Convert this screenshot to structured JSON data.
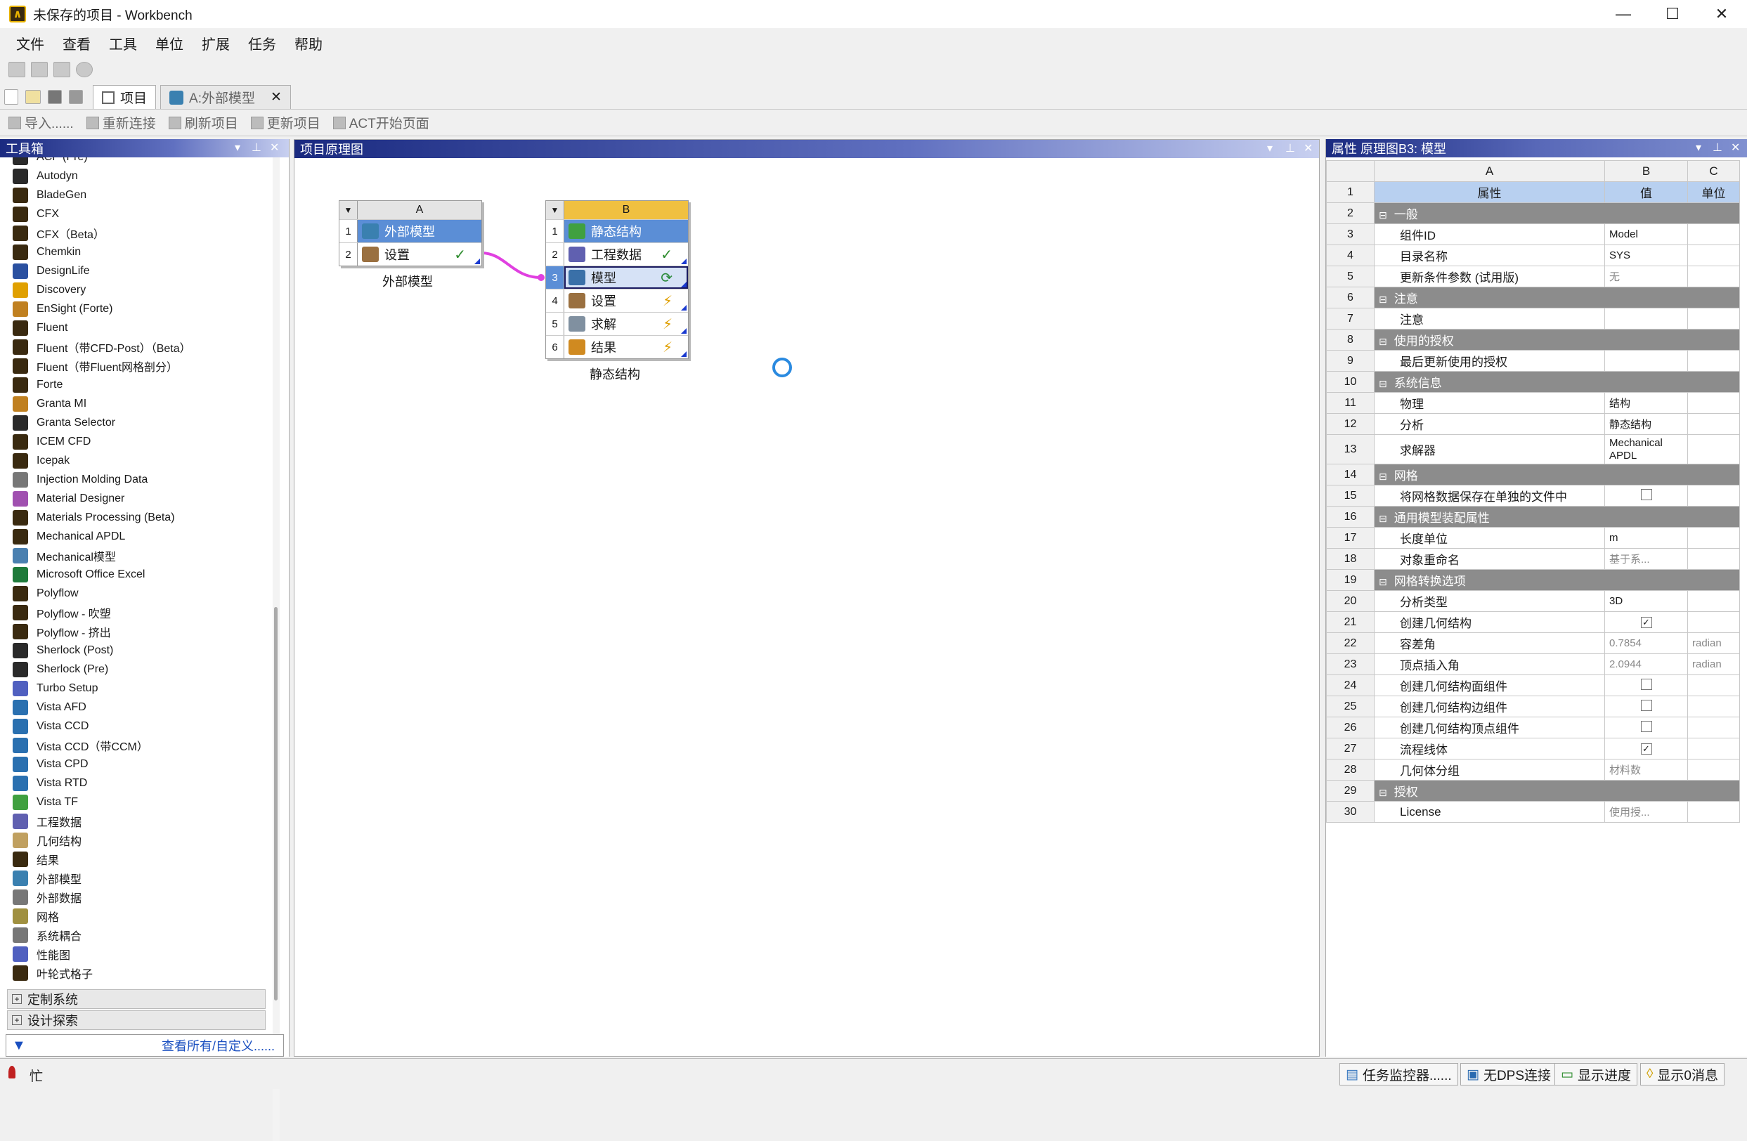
{
  "window": {
    "title": "未保存的项目 - Workbench"
  },
  "menu": [
    "文件",
    "查看",
    "工具",
    "单位",
    "扩展",
    "任务",
    "帮助"
  ],
  "tabs": [
    {
      "label": "项目"
    },
    {
      "label": "A:外部模型"
    }
  ],
  "toolbar": {
    "import": "导入......",
    "reconnect": "重新连接",
    "refresh": "刷新项目",
    "update": "更新项目",
    "act": "ACT开始页面"
  },
  "toolbox": {
    "title": "工具箱",
    "items": [
      {
        "label": "ACP (Pre)",
        "color": "#2a2a2a"
      },
      {
        "label": "Autodyn",
        "color": "#2a2a2a"
      },
      {
        "label": "BladeGen",
        "color": "#3a2a10"
      },
      {
        "label": "CFX",
        "color": "#3a2a10"
      },
      {
        "label": "CFX（Beta）",
        "color": "#3a2a10"
      },
      {
        "label": "Chemkin",
        "color": "#3a2a10"
      },
      {
        "label": "DesignLife",
        "color": "#2a50a0"
      },
      {
        "label": "Discovery",
        "color": "#e0a000"
      },
      {
        "label": "EnSight (Forte)",
        "color": "#c08020"
      },
      {
        "label": "Fluent",
        "color": "#3a2a10"
      },
      {
        "label": "Fluent（带CFD-Post）（Beta）",
        "color": "#3a2a10"
      },
      {
        "label": "Fluent（带Fluent网格剖分）",
        "color": "#3a2a10"
      },
      {
        "label": "Forte",
        "color": "#3a2a10"
      },
      {
        "label": "Granta MI",
        "color": "#c08020"
      },
      {
        "label": "Granta Selector",
        "color": "#2a2a2a"
      },
      {
        "label": "ICEM CFD",
        "color": "#3a2a10"
      },
      {
        "label": "Icepak",
        "color": "#3a2a10"
      },
      {
        "label": "Injection Molding Data",
        "color": "#777777"
      },
      {
        "label": "Material Designer",
        "color": "#a050b0"
      },
      {
        "label": "Materials Processing (Beta)",
        "color": "#3a2a10"
      },
      {
        "label": "Mechanical APDL",
        "color": "#3a2a10"
      },
      {
        "label": "Mechanical模型",
        "color": "#4a80b0"
      },
      {
        "label": "Microsoft Office Excel",
        "color": "#1e7a3a"
      },
      {
        "label": "Polyflow",
        "color": "#3a2a10"
      },
      {
        "label": "Polyflow - 吹塑",
        "color": "#3a2a10"
      },
      {
        "label": "Polyflow - 挤出",
        "color": "#3a2a10"
      },
      {
        "label": "Sherlock (Post)",
        "color": "#2a2a2a"
      },
      {
        "label": "Sherlock (Pre)",
        "color": "#2a2a2a"
      },
      {
        "label": "Turbo Setup",
        "color": "#5060c0"
      },
      {
        "label": "Vista AFD",
        "color": "#2a70b0"
      },
      {
        "label": "Vista CCD",
        "color": "#2a70b0"
      },
      {
        "label": "Vista CCD（带CCM）",
        "color": "#2a70b0"
      },
      {
        "label": "Vista CPD",
        "color": "#2a70b0"
      },
      {
        "label": "Vista RTD",
        "color": "#2a70b0"
      },
      {
        "label": "Vista TF",
        "color": "#40a040"
      },
      {
        "label": "工程数据",
        "color": "#6060b0"
      },
      {
        "label": "几何结构",
        "color": "#c0a060"
      },
      {
        "label": "结果",
        "color": "#3a2a10"
      },
      {
        "label": "外部模型",
        "color": "#3a80b0"
      },
      {
        "label": "外部数据",
        "color": "#777777"
      },
      {
        "label": "网格",
        "color": "#a09040"
      },
      {
        "label": "系统耦合",
        "color": "#777777"
      },
      {
        "label": "性能图",
        "color": "#5060c0"
      },
      {
        "label": "叶轮式格子",
        "color": "#3a2a10"
      }
    ],
    "groups": [
      "定制系统",
      "设计探索"
    ],
    "view_all": "查看所有/自定义......"
  },
  "schematic": {
    "title": "项目原理图",
    "system_a": {
      "col": "A",
      "caption": "外部模型",
      "rows": [
        {
          "n": "1",
          "label": "外部模型",
          "status": ""
        },
        {
          "n": "2",
          "label": "设置",
          "status": "✓"
        }
      ]
    },
    "system_b": {
      "col": "B",
      "caption": "静态结构",
      "rows": [
        {
          "n": "1",
          "label": "静态结构",
          "status": ""
        },
        {
          "n": "2",
          "label": "工程数据",
          "status": "✓"
        },
        {
          "n": "3",
          "label": "模型",
          "status": "⟳"
        },
        {
          "n": "4",
          "label": "设置",
          "status": "⚡"
        },
        {
          "n": "5",
          "label": "求解",
          "status": "⚡"
        },
        {
          "n": "6",
          "label": "结果",
          "status": "⚡"
        }
      ]
    }
  },
  "properties": {
    "title": "属性 原理图B3: 模型",
    "col_headers": [
      "A",
      "B",
      "C"
    ],
    "header_row": {
      "n": "1",
      "a": "属性",
      "b": "值",
      "c": "单位"
    },
    "rows": [
      {
        "n": "2",
        "sec": true,
        "a": "一般"
      },
      {
        "n": "3",
        "a": "组件ID",
        "b": "Model",
        "c": ""
      },
      {
        "n": "4",
        "a": "目录名称",
        "b": "SYS",
        "c": ""
      },
      {
        "n": "5",
        "a": "更新条件参数 (试用版)",
        "b": "无",
        "c": "",
        "dim": true
      },
      {
        "n": "6",
        "sec": true,
        "a": "注意"
      },
      {
        "n": "7",
        "a": "注意",
        "b": "",
        "c": ""
      },
      {
        "n": "8",
        "sec": true,
        "a": "使用的授权"
      },
      {
        "n": "9",
        "a": "最后更新使用的授权",
        "b": "",
        "c": ""
      },
      {
        "n": "10",
        "sec": true,
        "a": "系统信息"
      },
      {
        "n": "11",
        "a": "物理",
        "b": "结构",
        "c": ""
      },
      {
        "n": "12",
        "a": "分析",
        "b": "静态结构",
        "c": ""
      },
      {
        "n": "13",
        "a": "求解器",
        "b": "Mechanical APDL",
        "c": "",
        "tall": true
      },
      {
        "n": "14",
        "sec": true,
        "a": "网格"
      },
      {
        "n": "15",
        "a": "将网格数据保存在单独的文件中",
        "b": "",
        "c": "",
        "chk": "off"
      },
      {
        "n": "16",
        "sec": true,
        "a": "通用模型装配属性"
      },
      {
        "n": "17",
        "a": "长度单位",
        "b": "m",
        "c": ""
      },
      {
        "n": "18",
        "a": "对象重命名",
        "b": "基于系...",
        "c": "",
        "dim": true
      },
      {
        "n": "19",
        "sec": true,
        "a": "网格转换选项"
      },
      {
        "n": "20",
        "a": "分析类型",
        "b": "3D",
        "c": ""
      },
      {
        "n": "21",
        "a": "创建几何结构",
        "b": "",
        "c": "",
        "chk": "on"
      },
      {
        "n": "22",
        "a": "容差角",
        "b": "0.7854",
        "c": "radian",
        "dim": true
      },
      {
        "n": "23",
        "a": "顶点插入角",
        "b": "2.0944",
        "c": "radian",
        "dim": true
      },
      {
        "n": "24",
        "a": "创建几何结构面组件",
        "b": "",
        "c": "",
        "chk": "off"
      },
      {
        "n": "25",
        "a": "创建几何结构边组件",
        "b": "",
        "c": "",
        "chk": "off"
      },
      {
        "n": "26",
        "a": "创建几何结构顶点组件",
        "b": "",
        "c": "",
        "chk": "off"
      },
      {
        "n": "27",
        "a": "流程线体",
        "b": "",
        "c": "",
        "chk": "on"
      },
      {
        "n": "28",
        "a": "几何体分组",
        "b": "材料数",
        "c": "",
        "dim": true
      },
      {
        "n": "29",
        "sec": true,
        "a": "授权"
      },
      {
        "n": "30",
        "a": "License",
        "b": "使用授...",
        "c": "",
        "dim": true
      }
    ]
  },
  "statusbar": {
    "busy": "忙",
    "task_monitor": "任务监控器......",
    "dps": "无DPS连接",
    "progress": "显示进度",
    "messages": "显示0消息"
  },
  "colors": {
    "accent": "#4a7cc7",
    "header_blue": "#1a2a80",
    "selection": "#5b8ed6"
  }
}
